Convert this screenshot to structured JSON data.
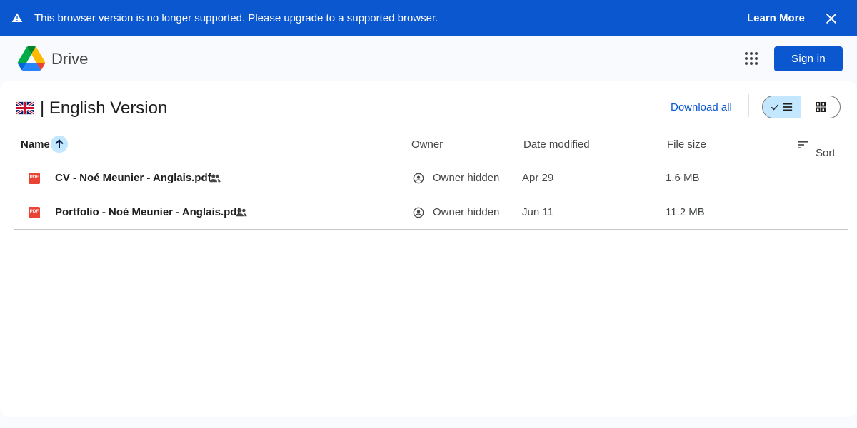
{
  "banner": {
    "message": "This browser version is no longer supported. Please upgrade to a supported browser.",
    "learn_more": "Learn More",
    "icons": {
      "warning": "warning-icon",
      "close": "close-icon"
    }
  },
  "header": {
    "brand": "Drive",
    "sign_in": "Sign in",
    "icons": {
      "logo": "google-drive-logo",
      "apps": "apps-grid-icon"
    }
  },
  "folder": {
    "title": "| English Version",
    "flag_icon": "uk-flag-icon",
    "download_all": "Download all",
    "view_toggle": {
      "selected": "list",
      "options": [
        "list",
        "grid"
      ]
    }
  },
  "table": {
    "columns": {
      "name": "Name",
      "owner": "Owner",
      "date": "Date modified",
      "size": "File size",
      "sort": "Sort"
    },
    "sort_direction": "ascending",
    "rows": [
      {
        "name": "CV - Noé Meunier - Anglais.pdf",
        "type_badge": "PDF",
        "shared": true,
        "owner": "Owner hidden",
        "date": "Apr 29",
        "size": "1.6 MB"
      },
      {
        "name": "Portfolio - Noé Meunier - Anglais.pdf",
        "type_badge": "PDF",
        "shared": true,
        "owner": "Owner hidden",
        "date": "Jun 11",
        "size": "11.2 MB"
      }
    ]
  },
  "colors": {
    "banner_bg": "#0b57d0",
    "accent": "#0b57d0",
    "selected_toggle": "#c2e7ff",
    "pdf_red": "#ea4335",
    "page_bg": "#f8fafd"
  }
}
